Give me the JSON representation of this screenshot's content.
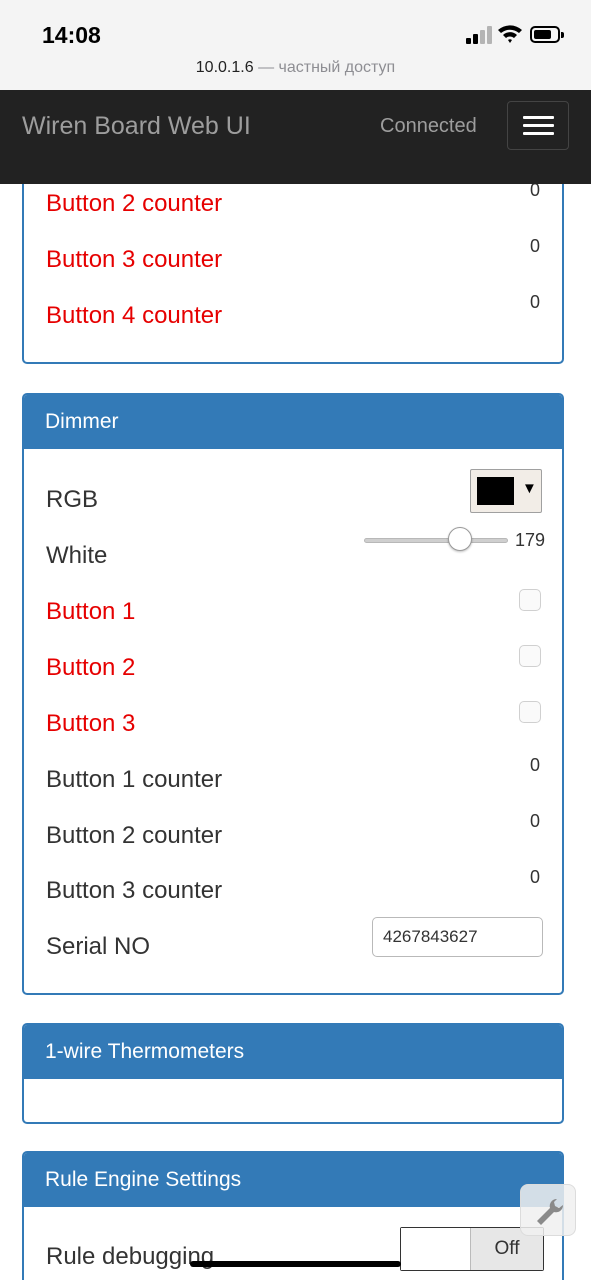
{
  "status_bar": {
    "time": "14:08",
    "host": "10.0.1.6",
    "privacy": "— частный доступ",
    "icons": [
      "cellular-signal-icon",
      "wifi-icon",
      "battery-icon"
    ]
  },
  "navbar": {
    "brand": "Wiren Board Web UI",
    "status": "Connected",
    "menu_icon": "hamburger-menu-icon"
  },
  "panels": {
    "top": {
      "rows": [
        {
          "label": "Button 2 counter",
          "value": "0"
        },
        {
          "label": "Button 3 counter",
          "value": "0"
        },
        {
          "label": "Button 4 counter",
          "value": "0"
        }
      ]
    },
    "dimmer": {
      "title": "Dimmer",
      "rgb_label": "RGB",
      "rgb_color": "#000000",
      "rgb_caret": "▼",
      "white_label": "White",
      "white_value": "179",
      "white_fraction": 0.7,
      "button1_label": "Button 1",
      "button2_label": "Button 2",
      "button3_label": "Button 3",
      "counters": [
        {
          "label": "Button 1 counter",
          "value": "0"
        },
        {
          "label": "Button 2 counter",
          "value": "0"
        },
        {
          "label": "Button 3 counter",
          "value": "0"
        }
      ],
      "serial_label": "Serial NO",
      "serial_value": "4267843627"
    },
    "onewire": {
      "title": "1-wire Thermometers"
    },
    "rules": {
      "title": "Rule Engine Settings",
      "debug_label": "Rule debugging",
      "debug_state": "Off"
    }
  },
  "colors": {
    "navbar_bg": "#222222",
    "panel_primary": "#337ab7",
    "error_label": "#e60000"
  },
  "fab_icon": "wrench-icon"
}
